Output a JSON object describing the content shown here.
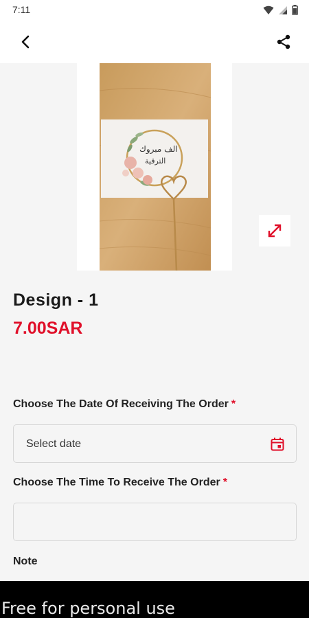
{
  "status_bar": {
    "time": "7:11"
  },
  "app_bar": {
    "back_icon": "arrow-back-icon",
    "share_icon": "share-icon"
  },
  "product": {
    "image_icon": "product-photo",
    "image_text_line1": "الف مبروك",
    "image_text_line2": "الترقية",
    "title": "Design - 1",
    "price": "7.00SAR"
  },
  "form": {
    "date_label": "Choose The Date Of Receiving The Order",
    "date_required": "*",
    "date_placeholder": "Select date",
    "time_label": "Choose The Time To Receive The Order",
    "time_required": "*",
    "time_value": "",
    "note_label": "Note"
  },
  "banner": {
    "text": "Free for personal use"
  },
  "colors": {
    "accent": "#e0102a",
    "background": "#f5f5f5"
  }
}
